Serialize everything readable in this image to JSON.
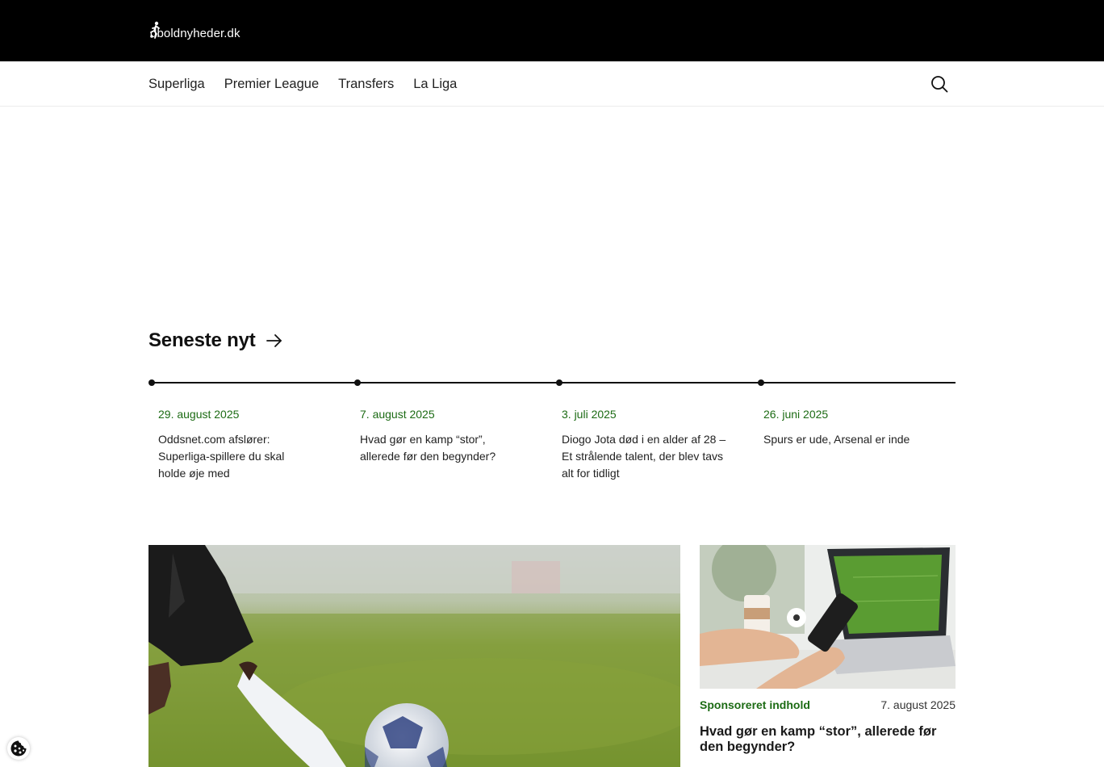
{
  "site": {
    "logo_text": "dboldnyheder.dk",
    "logo_icon": "soccer-player-icon"
  },
  "nav": {
    "items": [
      {
        "label": "Superliga"
      },
      {
        "label": "Premier League"
      },
      {
        "label": "Transfers"
      },
      {
        "label": "La Liga"
      }
    ],
    "search_icon": "search-icon"
  },
  "latest": {
    "title": "Seneste nyt",
    "arrow_icon": "arrow-right-icon",
    "items": [
      {
        "date": "29. august 2025",
        "title": "Oddsnet.com afslører: Superliga-spillere du skal holde øje med"
      },
      {
        "date": "7. august 2025",
        "title": "Hvad gør en kamp “stor”, allerede før den begynder?"
      },
      {
        "date": "3. juli 2025",
        "title": "Diogo Jota død i en alder af 28 – Et strålende talent, der blev tavs alt for tidligt"
      },
      {
        "date": "26. juni 2025",
        "title": "Spurs er ude, Arsenal er inde"
      }
    ]
  },
  "featured": {
    "image_alt_icon": "soccer-kick-photo"
  },
  "side_article": {
    "tag": "Sponsoreret indhold",
    "date": "7. august 2025",
    "title": "Hvad gør en kamp “stor”, allerede før den begynder?",
    "image_icon": "phone-laptop-football-photo"
  },
  "cookie": {
    "icon": "cookie-icon"
  },
  "colors": {
    "accent_green": "#1c6b14",
    "header_bg": "#000000"
  }
}
